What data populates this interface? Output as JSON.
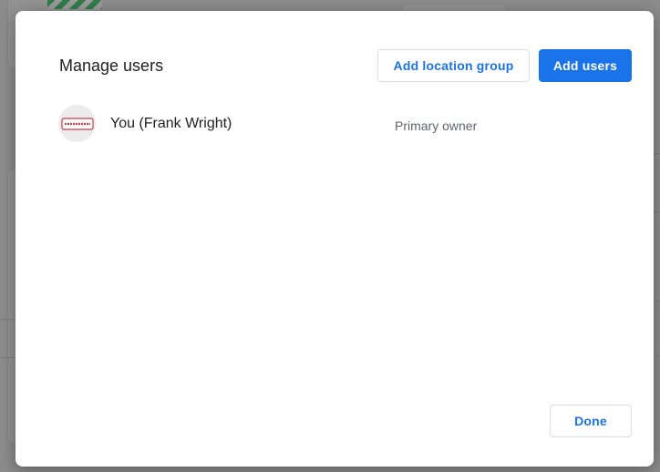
{
  "dialog": {
    "title": "Manage users",
    "add_location_group_label": "Add location group",
    "add_users_label": "Add users",
    "done_label": "Done"
  },
  "users": [
    {
      "name": "You (Frank Wright)",
      "role": "Primary owner",
      "avatar_logo_text": "THREESIXES"
    }
  ],
  "colors": {
    "accent": "#1a73e8",
    "logo": "#d23a4f"
  }
}
